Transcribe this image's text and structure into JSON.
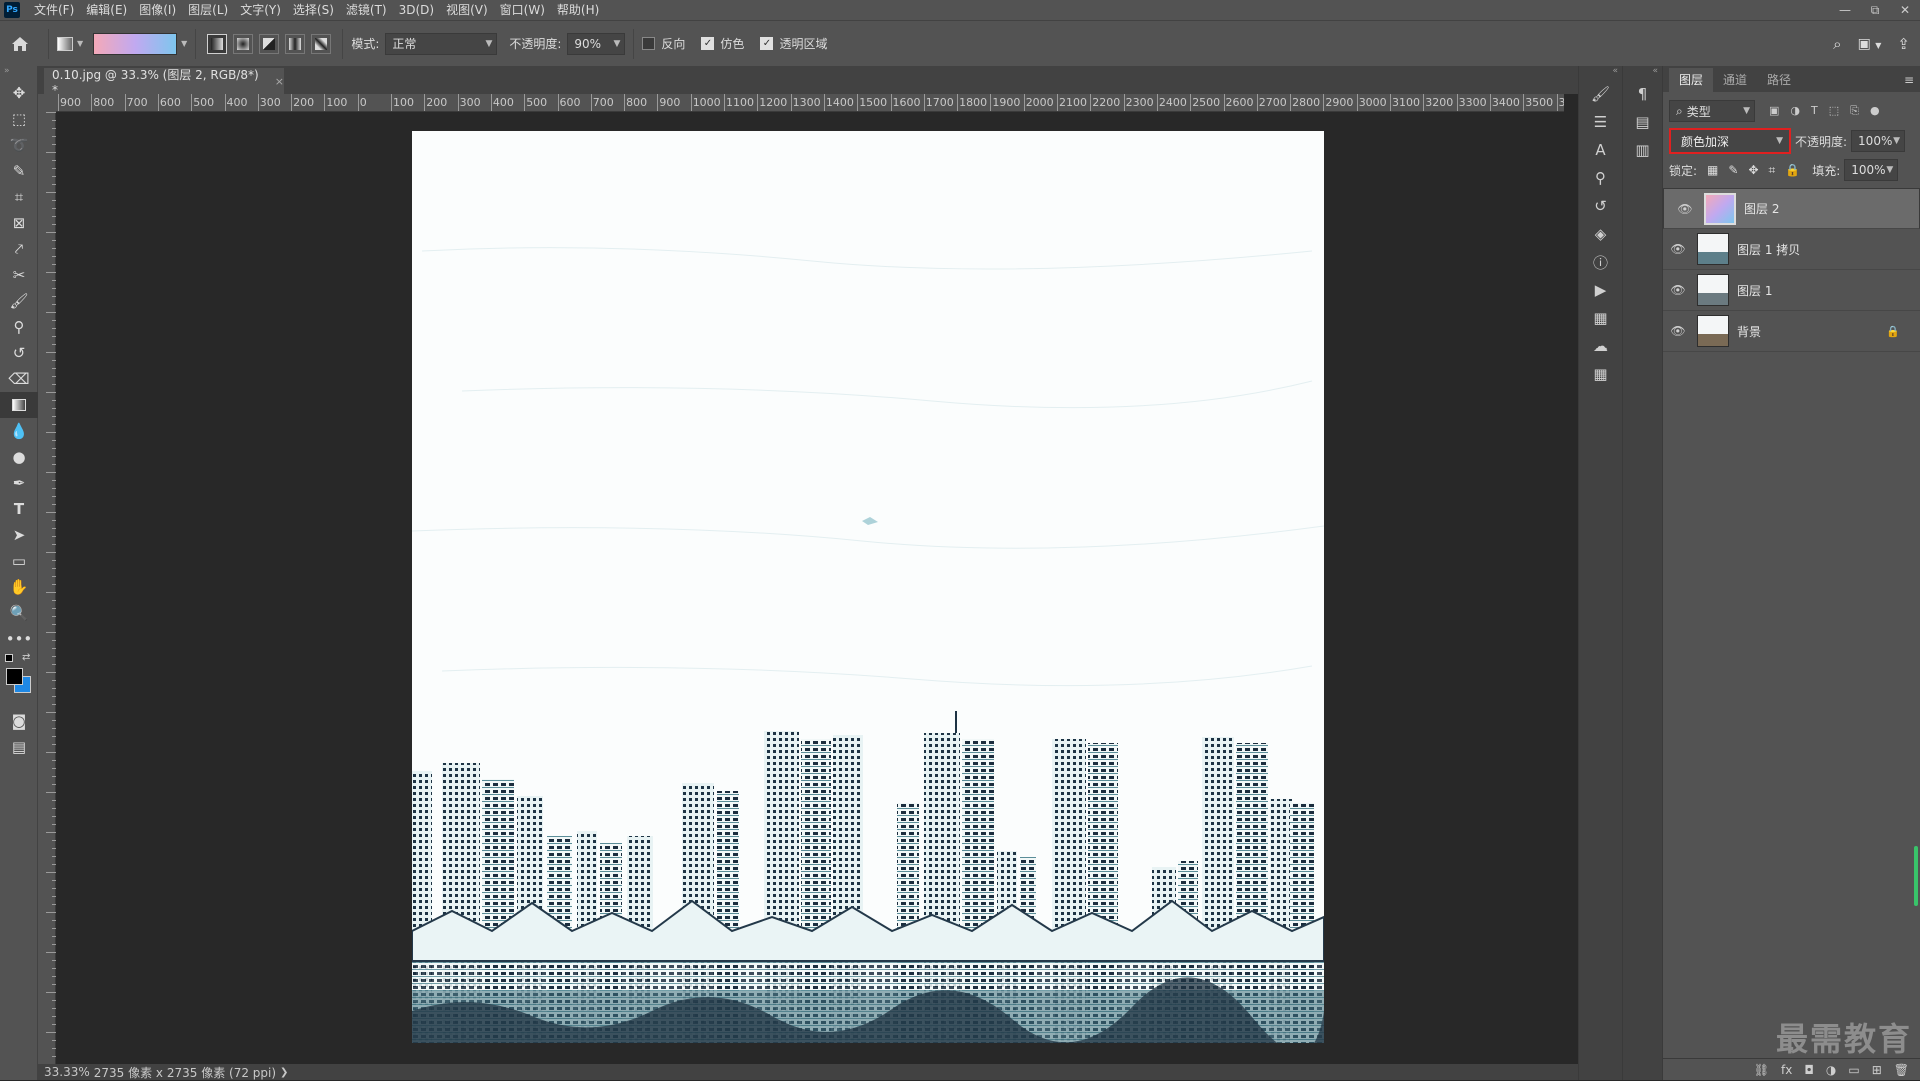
{
  "app": {
    "logo": "Ps"
  },
  "menu": [
    "文件(F)",
    "编辑(E)",
    "图像(I)",
    "图层(L)",
    "文字(Y)",
    "选择(S)",
    "滤镜(T)",
    "3D(D)",
    "视图(V)",
    "窗口(W)",
    "帮助(H)"
  ],
  "window_controls": {
    "minimize": "—",
    "restore": "⧉",
    "close": "✕"
  },
  "options": {
    "mode_label": "模式:",
    "mode_value": "正常",
    "opacity_label": "不透明度:",
    "opacity_value": "90%",
    "reverse_label": "反向",
    "reverse_checked": false,
    "dither_label": "仿色",
    "dither_checked": true,
    "transparency_label": "透明区域",
    "transparency_checked": true
  },
  "document": {
    "tab_title": "0.10.jpg @ 33.3% (图层 2, RGB/8*) *",
    "close": "×"
  },
  "ruler": {
    "h_labels": [
      "900",
      "800",
      "700",
      "600",
      "500",
      "400",
      "300",
      "200",
      "100",
      "0",
      "100",
      "200",
      "300",
      "400",
      "500",
      "600",
      "700",
      "800",
      "900",
      "1000",
      "1100",
      "1200",
      "1300",
      "1400",
      "1500",
      "1600",
      "1700",
      "1800",
      "1900",
      "2000",
      "2100",
      "2200",
      "2300",
      "2400",
      "2500",
      "2600",
      "2700",
      "2800",
      "2900",
      "3000",
      "3100",
      "3200",
      "3300",
      "3400",
      "3500",
      "3"
    ]
  },
  "status": {
    "zoom": "33.33%",
    "info": "2735 像素 x 2735 像素 (72 ppi)"
  },
  "layers_panel": {
    "tabs": [
      "图层",
      "通道",
      "路径"
    ],
    "filter_label": "类型",
    "blend_mode": "颜色加深",
    "opacity_label": "不透明度:",
    "opacity_value": "100%",
    "lock_label": "锁定:",
    "fill_label": "填充:",
    "fill_value": "100%",
    "layers": [
      {
        "name": "图层 2",
        "selected": true,
        "locked": false
      },
      {
        "name": "图层 1 拷贝",
        "selected": false,
        "locked": false
      },
      {
        "name": "图层 1",
        "selected": false,
        "locked": false
      },
      {
        "name": "背景",
        "selected": false,
        "locked": true
      }
    ]
  },
  "watermark": "最需教育",
  "colors": {
    "accent_highlight": "#e02020",
    "foreground": "#000000",
    "background": "#1e88e5"
  }
}
